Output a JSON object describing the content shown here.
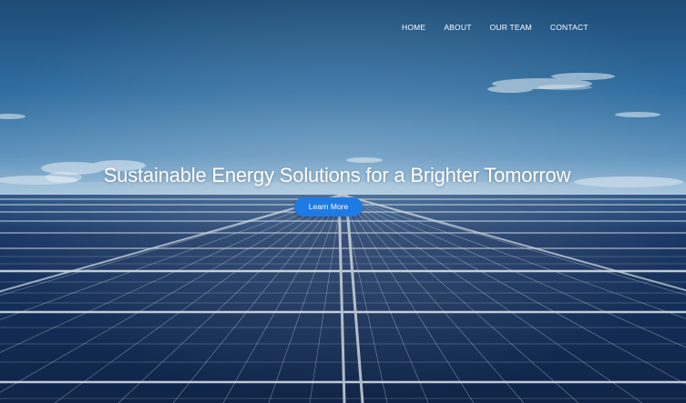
{
  "nav": {
    "items": [
      {
        "label": "HOME"
      },
      {
        "label": "ABOUT"
      },
      {
        "label": "OUR TEAM"
      },
      {
        "label": "CONTACT"
      }
    ]
  },
  "hero": {
    "headline": "Sustainable Energy Solutions for a Brighter Tomorrow",
    "cta_label": "Learn More",
    "background": "solar-panels-under-blue-sky",
    "colors": {
      "sky_top": "#1f4f7a",
      "sky_mid": "#3f7fae",
      "horizon": "#a9c7df",
      "panel": "#142a4a",
      "panel_grid": "#c9d6e2",
      "cta": "#1e7be3",
      "text": "#ffffff"
    }
  }
}
